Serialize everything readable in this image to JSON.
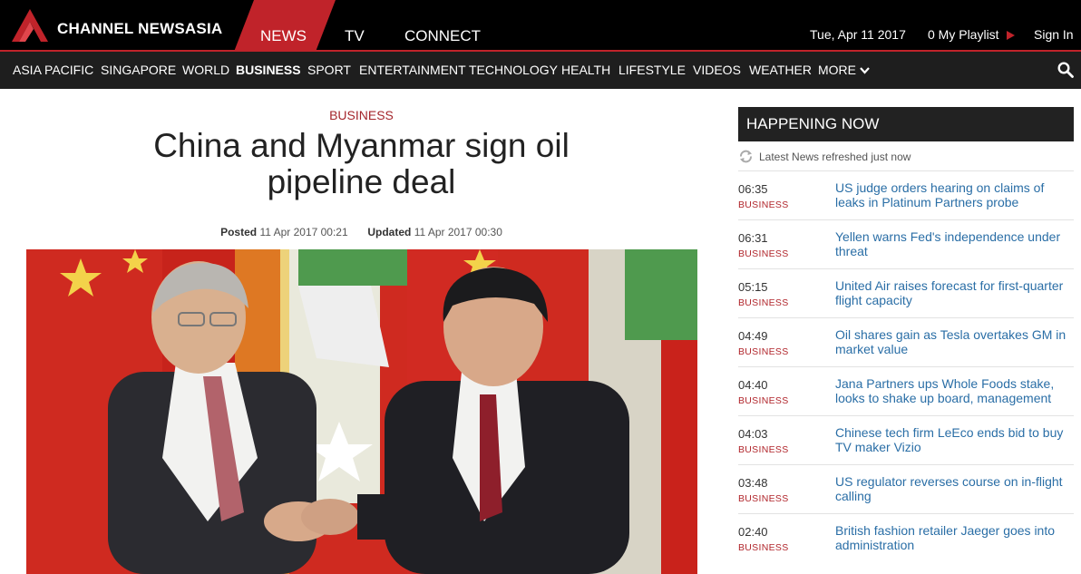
{
  "header": {
    "brand": "CHANNEL NEWSASIA",
    "tabs": [
      "NEWS",
      "TV",
      "CONNECT"
    ],
    "date": "Tue, Apr 11 2017",
    "playlist": "0 My Playlist",
    "sign_in": "Sign In"
  },
  "nav": {
    "items": [
      "ASIA PACIFIC",
      "SINGAPORE",
      "WORLD",
      "BUSINESS",
      "SPORT",
      "ENTERTAINMENT",
      "TECHNOLOGY",
      "HEALTH",
      "LIFESTYLE",
      "VIDEOS",
      "WEATHER",
      "MORE"
    ],
    "active": "BUSINESS",
    "search_icon": "search-icon"
  },
  "article": {
    "section": "BUSINESS",
    "headline": "China and Myanmar sign oil pipeline deal",
    "posted_label": "Posted",
    "posted": "11 Apr 2017 00:21",
    "updated_label": "Updated",
    "updated": "11 Apr 2017 00:30"
  },
  "happening_now": {
    "title": "HAPPENING NOW",
    "refresh_text": "Latest News refreshed just now",
    "items": [
      {
        "time": "06:35",
        "category": "BUSINESS",
        "title": "US judge orders hearing on claims of leaks in Platinum Partners probe"
      },
      {
        "time": "06:31",
        "category": "BUSINESS",
        "title": "Yellen warns Fed's independence under threat"
      },
      {
        "time": "05:15",
        "category": "BUSINESS",
        "title": "United Air raises forecast for first-quarter flight capacity"
      },
      {
        "time": "04:49",
        "category": "BUSINESS",
        "title": "Oil shares gain as Tesla overtakes GM in market value"
      },
      {
        "time": "04:40",
        "category": "BUSINESS",
        "title": "Jana Partners ups Whole Foods stake, looks to shake up board, management"
      },
      {
        "time": "04:03",
        "category": "BUSINESS",
        "title": "Chinese tech firm LeEco ends bid to buy TV maker Vizio"
      },
      {
        "time": "03:48",
        "category": "BUSINESS",
        "title": "US regulator reverses course on in-flight calling"
      },
      {
        "time": "02:40",
        "category": "BUSINESS",
        "title": "British fashion retailer Jaeger goes into administration"
      }
    ]
  },
  "colors": {
    "brand_red": "#c0232a",
    "link_blue": "#2a6ea6",
    "nav_bg": "#1e1e1e"
  }
}
